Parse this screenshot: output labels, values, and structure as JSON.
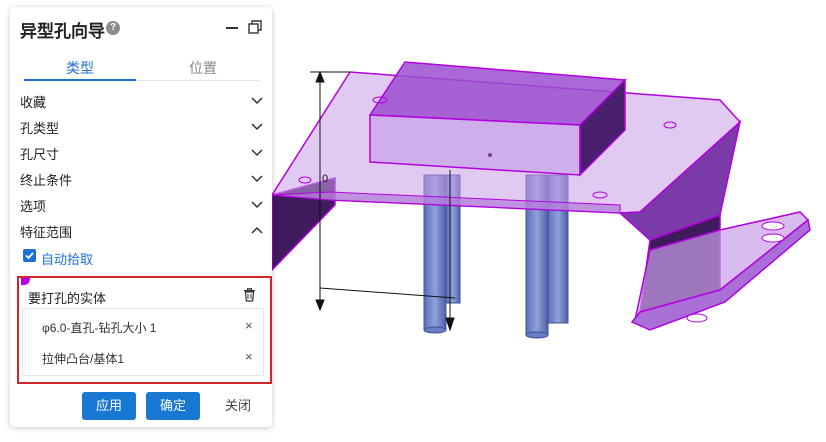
{
  "panel": {
    "title": "异型孔向导",
    "help_icon": "?",
    "tabs": {
      "type": "类型",
      "position": "位置"
    },
    "sections": [
      {
        "label": "收藏",
        "state": "collapsed"
      },
      {
        "label": "孔类型",
        "state": "collapsed"
      },
      {
        "label": "孔尺寸",
        "state": "collapsed"
      },
      {
        "label": "终止条件",
        "state": "collapsed"
      },
      {
        "label": "选项",
        "state": "collapsed"
      },
      {
        "label": "特征范围",
        "state": "expanded"
      }
    ],
    "auto_pick_label": "自动拾取",
    "auto_pick_checked": true,
    "bodies_label": "要打孔的实体",
    "bodies": [
      {
        "name": "φ6.0-直孔-钻孔大小 1",
        "remove": "×"
      },
      {
        "name": "拉伸凸台/基体1",
        "remove": "×"
      }
    ],
    "buttons": {
      "apply": "应用",
      "ok": "确定",
      "close": "关闭"
    }
  },
  "colors": {
    "accent": "#1877d2",
    "highlight": "#d4232b",
    "selection": "#b300e0"
  },
  "viewport": {
    "dimension_label": "0"
  }
}
